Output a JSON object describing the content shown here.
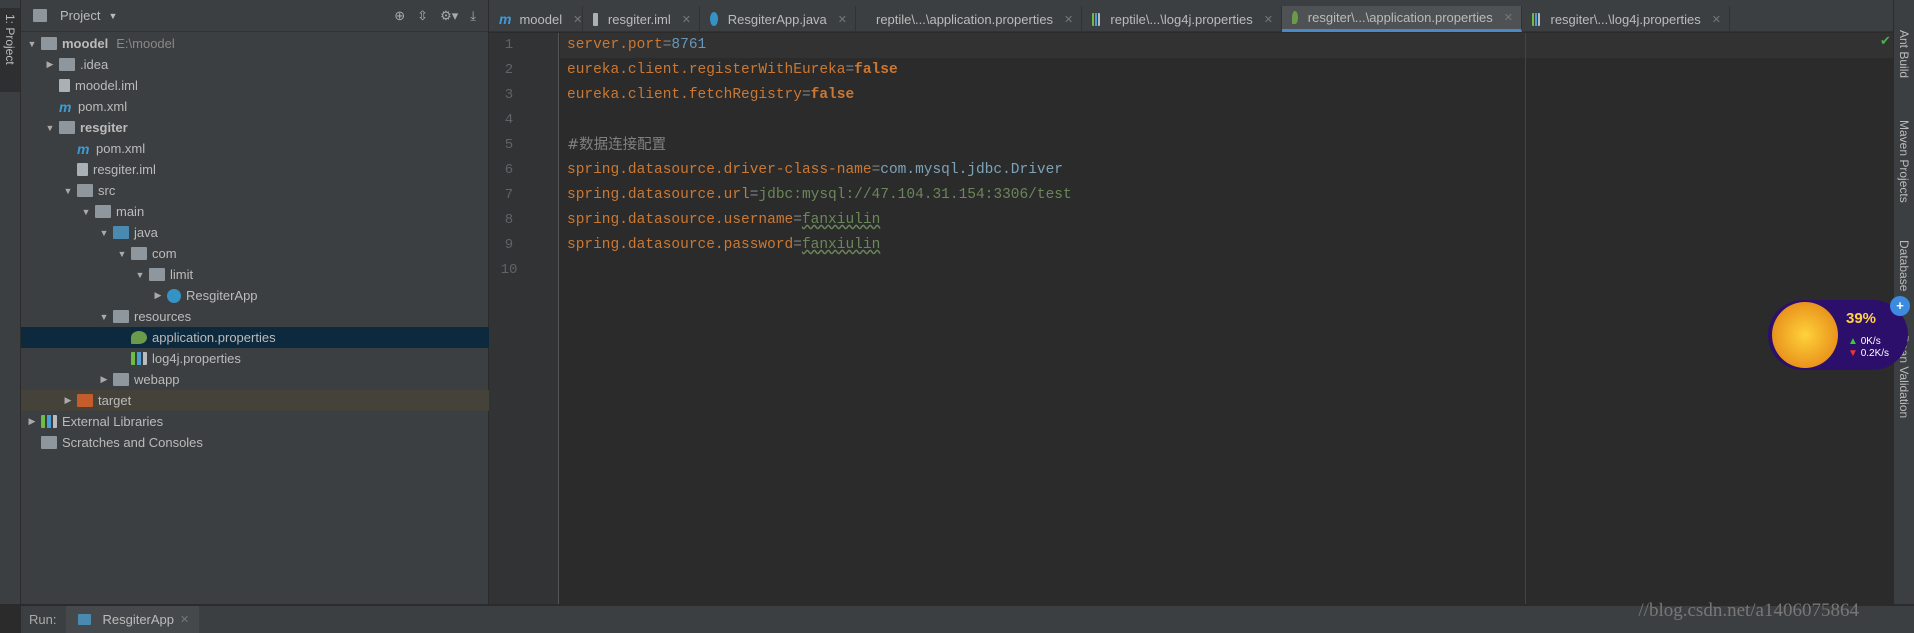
{
  "left_strip": {
    "project_tab": "1: Project"
  },
  "project_panel": {
    "title": "Project",
    "tree": [
      {
        "label": "moodel",
        "hint": "E:\\moodel",
        "depth": 0,
        "arrow": "down",
        "icon": "module-folder",
        "bold": true
      },
      {
        "label": ".idea",
        "depth": 1,
        "arrow": "right",
        "icon": "folder"
      },
      {
        "label": "moodel.iml",
        "depth": 1,
        "arrow": "",
        "icon": "iml-file"
      },
      {
        "label": "pom.xml",
        "depth": 1,
        "arrow": "",
        "icon": "maven"
      },
      {
        "label": "resgiter",
        "depth": 1,
        "arrow": "down",
        "icon": "module-folder",
        "bold": true
      },
      {
        "label": "pom.xml",
        "depth": 2,
        "arrow": "",
        "icon": "maven"
      },
      {
        "label": "resgiter.iml",
        "depth": 2,
        "arrow": "",
        "icon": "iml-file"
      },
      {
        "label": "src",
        "depth": 2,
        "arrow": "down",
        "icon": "folder"
      },
      {
        "label": "main",
        "depth": 3,
        "arrow": "down",
        "icon": "folder"
      },
      {
        "label": "java",
        "depth": 4,
        "arrow": "down",
        "icon": "source-folder"
      },
      {
        "label": "com",
        "depth": 5,
        "arrow": "down",
        "icon": "package"
      },
      {
        "label": "limit",
        "depth": 6,
        "arrow": "down",
        "icon": "package"
      },
      {
        "label": "ResgiterApp",
        "depth": 7,
        "arrow": "right",
        "icon": "spring-class"
      },
      {
        "label": "resources",
        "depth": 4,
        "arrow": "down",
        "icon": "resources-folder"
      },
      {
        "label": "application.properties",
        "depth": 5,
        "arrow": "",
        "icon": "spring-properties",
        "selected": true
      },
      {
        "label": "log4j.properties",
        "depth": 5,
        "arrow": "",
        "icon": "properties-file"
      },
      {
        "label": "webapp",
        "depth": 4,
        "arrow": "right",
        "icon": "web-folder"
      },
      {
        "label": "target",
        "depth": 2,
        "arrow": "right",
        "icon": "excluded-folder",
        "excluded": true
      },
      {
        "label": "External Libraries",
        "depth": 0,
        "arrow": "right",
        "icon": "libraries"
      },
      {
        "label": "Scratches and Consoles",
        "depth": 0,
        "arrow": "",
        "icon": "scratches"
      }
    ]
  },
  "tabs": [
    {
      "label": "moodel",
      "icon": "maven"
    },
    {
      "label": "resgiter.iml",
      "icon": "iml-file"
    },
    {
      "label": "ResgiterApp.java",
      "icon": "spring-class"
    },
    {
      "label": "reptile\\...\\application.properties",
      "icon": "spring-properties"
    },
    {
      "label": "reptile\\...\\log4j.properties",
      "icon": "properties-file"
    },
    {
      "label": "resgiter\\...\\application.properties",
      "icon": "spring-properties",
      "active": true
    },
    {
      "label": "resgiter\\...\\log4j.properties",
      "icon": "properties-file"
    }
  ],
  "editor": {
    "lines": [
      {
        "n": "1",
        "key": "server.port",
        "eq": "=",
        "val": "8761",
        "vclass": "n"
      },
      {
        "n": "2",
        "key": "eureka.client.registerWithEureka",
        "eq": "=",
        "val": "false",
        "vclass": "b"
      },
      {
        "n": "3",
        "key": "eureka.client.fetchRegistry",
        "eq": "=",
        "val": "false",
        "vclass": "b"
      },
      {
        "n": "4",
        "key": "",
        "eq": "",
        "val": "",
        "vclass": ""
      },
      {
        "n": "5",
        "comment": "#数据连接配置"
      },
      {
        "n": "6",
        "key": "spring.datasource.driver-class-name",
        "eq": "=",
        "val": "com.mysql.jdbc.Driver",
        "vclass": "d"
      },
      {
        "n": "7",
        "key": "spring.datasource.url",
        "eq": "=",
        "val": "jdbc:mysql://47.104.31.154:3306/test",
        "vclass": "v"
      },
      {
        "n": "8",
        "key": "spring.datasource.username",
        "eq": "=",
        "val": "fanxiulin",
        "vclass": "v u"
      },
      {
        "n": "9",
        "key": "spring.datasource.password",
        "eq": "=",
        "val": "fanxiulin",
        "vclass": "v u"
      },
      {
        "n": "10",
        "key": "",
        "eq": "",
        "val": "",
        "vclass": ""
      }
    ]
  },
  "right_strip": {
    "items": [
      "Ant Build",
      "Maven Projects",
      "Database",
      "Bean Validation"
    ]
  },
  "bottom": {
    "run_label": "Run:",
    "run_tab": "ResgiterApp"
  },
  "widget": {
    "percent": "39%",
    "up": "0K/s",
    "down": "0.2K/s"
  },
  "watermark": "//blog.csdn.net/a1406075864"
}
